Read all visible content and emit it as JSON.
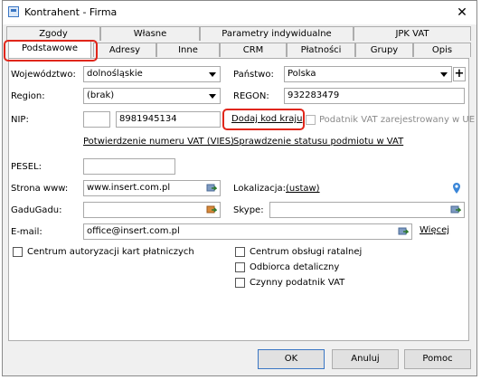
{
  "window": {
    "title": "Kontrahent - Firma",
    "close_glyph": "✕"
  },
  "tabs_row1": [
    {
      "label": "Zgody"
    },
    {
      "label": "Własne"
    },
    {
      "label": "Parametry indywidualne"
    },
    {
      "label": "JPK VAT"
    }
  ],
  "tabs_row2": [
    {
      "label": "Podstawowe",
      "active": true
    },
    {
      "label": "Adresy"
    },
    {
      "label": "Inne"
    },
    {
      "label": "CRM"
    },
    {
      "label": "Płatności"
    },
    {
      "label": "Grupy"
    },
    {
      "label": "Opis"
    }
  ],
  "form": {
    "wojewodztwo_label": "Województwo:",
    "wojewodztwo_value": "dolnośląskie",
    "panstwo_label": "Państwo:",
    "panstwo_value": "Polska",
    "plus_glyph": "+",
    "region_label": "Region:",
    "region_value": "(brak)",
    "regon_label": "REGON:",
    "regon_value": "932283479",
    "nip_label": "NIP:",
    "nip_prefix": "",
    "nip_value": "8981945134",
    "dodaj_kod_kraju": "Dodaj kod kraju",
    "podatnik_vat_zarej": "Podatnik VAT zarejestrowany w UE",
    "potwierdzenie_vat": "Potwierdzenie numeru VAT (VIES)",
    "sprawdzenie_statusu": "Sprawdzenie statusu podmiotu w VAT",
    "pesel_label": "PESEL:",
    "pesel_value": "",
    "strona_label": "Strona www:",
    "strona_value": "www.insert.com.pl",
    "lokalizacja_label": "Lokalizacja:",
    "lokalizacja_link": "(ustaw)",
    "gadugadu_label": "GaduGadu:",
    "gadugadu_value": "",
    "skype_label": "Skype:",
    "skype_value": "",
    "email_label": "E-mail:",
    "email_value": "office@insert.com.pl",
    "wiecej_link": "Więcej",
    "cb_centrum_kart": "Centrum autoryzacji kart płatniczych",
    "cb_centrum_ratalnej": "Centrum obsługi ratalnej",
    "cb_odbiorca": "Odbiorca detaliczny",
    "cb_czynny_vat": "Czynny podatnik VAT"
  },
  "buttons": {
    "ok": "OK",
    "anuluj": "Anuluj",
    "pomoc": "Pomoc"
  },
  "colors": {
    "highlight": "#e0261a",
    "accent": "#3a76c4"
  }
}
